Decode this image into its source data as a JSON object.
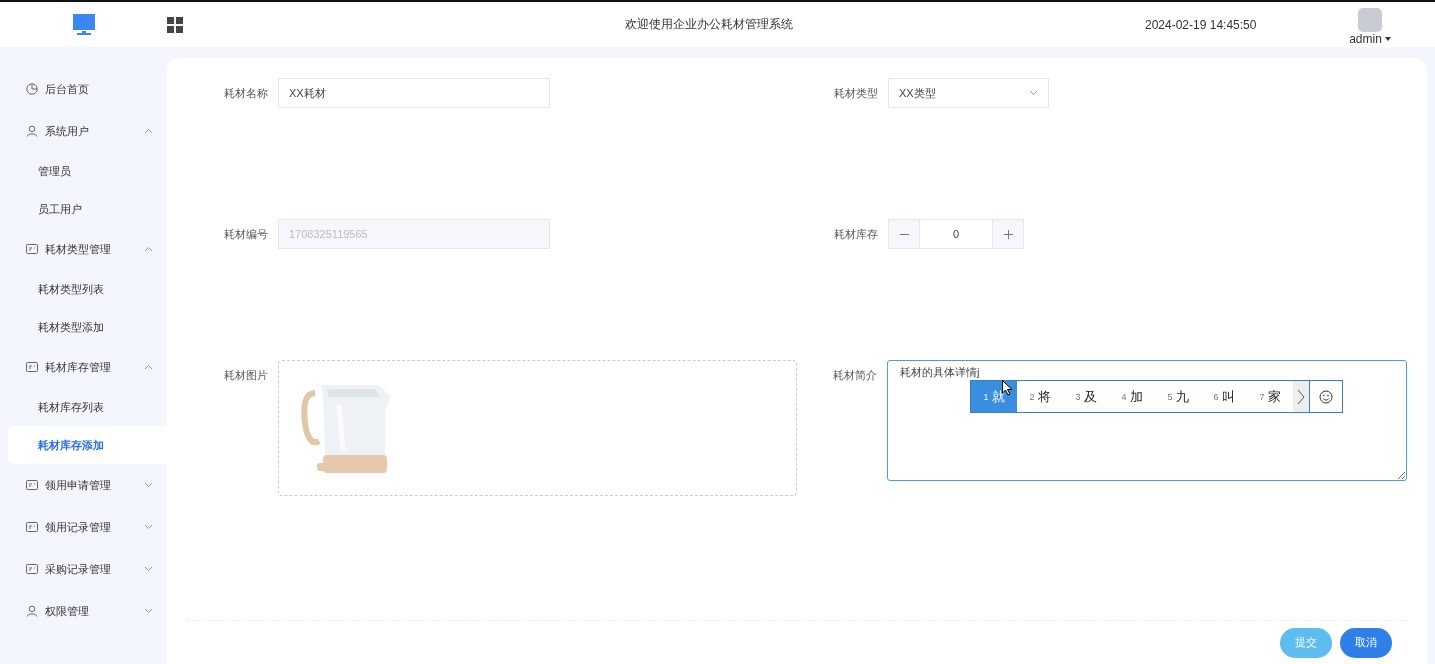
{
  "header": {
    "title": "欢迎使用企业办公耗材管理系统",
    "datetime": "2024-02-19 14:45:50",
    "user": "admin"
  },
  "sidebar": {
    "items": [
      {
        "label": "后台首页",
        "kind": "chart"
      },
      {
        "label": "系统用户",
        "kind": "user",
        "expanded": true,
        "children": [
          {
            "label": "管理员",
            "selected": false
          },
          {
            "label": "员工用户",
            "selected": false
          }
        ]
      },
      {
        "label": "耗材类型管理",
        "kind": "card",
        "expanded": true,
        "children": [
          {
            "label": "耗材类型列表",
            "selected": false
          },
          {
            "label": "耗材类型添加",
            "selected": false
          }
        ]
      },
      {
        "label": "耗材库存管理",
        "kind": "card",
        "expanded": true,
        "children": [
          {
            "label": "耗材库存列表",
            "selected": false
          },
          {
            "label": "耗材库存添加",
            "selected": true
          }
        ]
      },
      {
        "label": "领用申请管理",
        "kind": "card",
        "expanded": false
      },
      {
        "label": "领用记录管理",
        "kind": "card",
        "expanded": false
      },
      {
        "label": "采购记录管理",
        "kind": "card",
        "expanded": false
      },
      {
        "label": "权限管理",
        "kind": "user",
        "expanded": false
      }
    ]
  },
  "form": {
    "rows": [
      [
        {
          "label": "耗材名称",
          "kind": "text",
          "value": "XX耗材",
          "disabled": false
        },
        {
          "label": "耗材类型",
          "kind": "select",
          "value": "XX类型"
        }
      ],
      [
        {
          "label": "耗材编号",
          "kind": "text",
          "value": "1708325119565",
          "disabled": true
        },
        {
          "label": "耗材库存",
          "kind": "number",
          "value": "0"
        }
      ],
      [
        {
          "label": "耗材图片"
        },
        {
          "label": "耗材简介",
          "kind": "textarea",
          "value": "耗材的具体详情j",
          "focused": true,
          "ime": {
            "candidates": [
              {
                "number": "1",
                "text": "就",
                "selected": true
              },
              {
                "number": "2",
                "text": "将",
                "selected": false
              },
              {
                "number": "3",
                "text": "及",
                "selected": false
              },
              {
                "number": "4",
                "text": "加",
                "selected": false
              },
              {
                "number": "5",
                "text": "九",
                "selected": false
              },
              {
                "number": "6",
                "text": "叫",
                "selected": false
              },
              {
                "number": "7",
                "text": "家",
                "selected": false
              }
            ]
          }
        }
      ]
    ]
  },
  "buttons": [
    {
      "label": "提交",
      "kind": "submit",
      "disabled": true
    },
    {
      "label": "取消",
      "kind": "cancel"
    }
  ]
}
